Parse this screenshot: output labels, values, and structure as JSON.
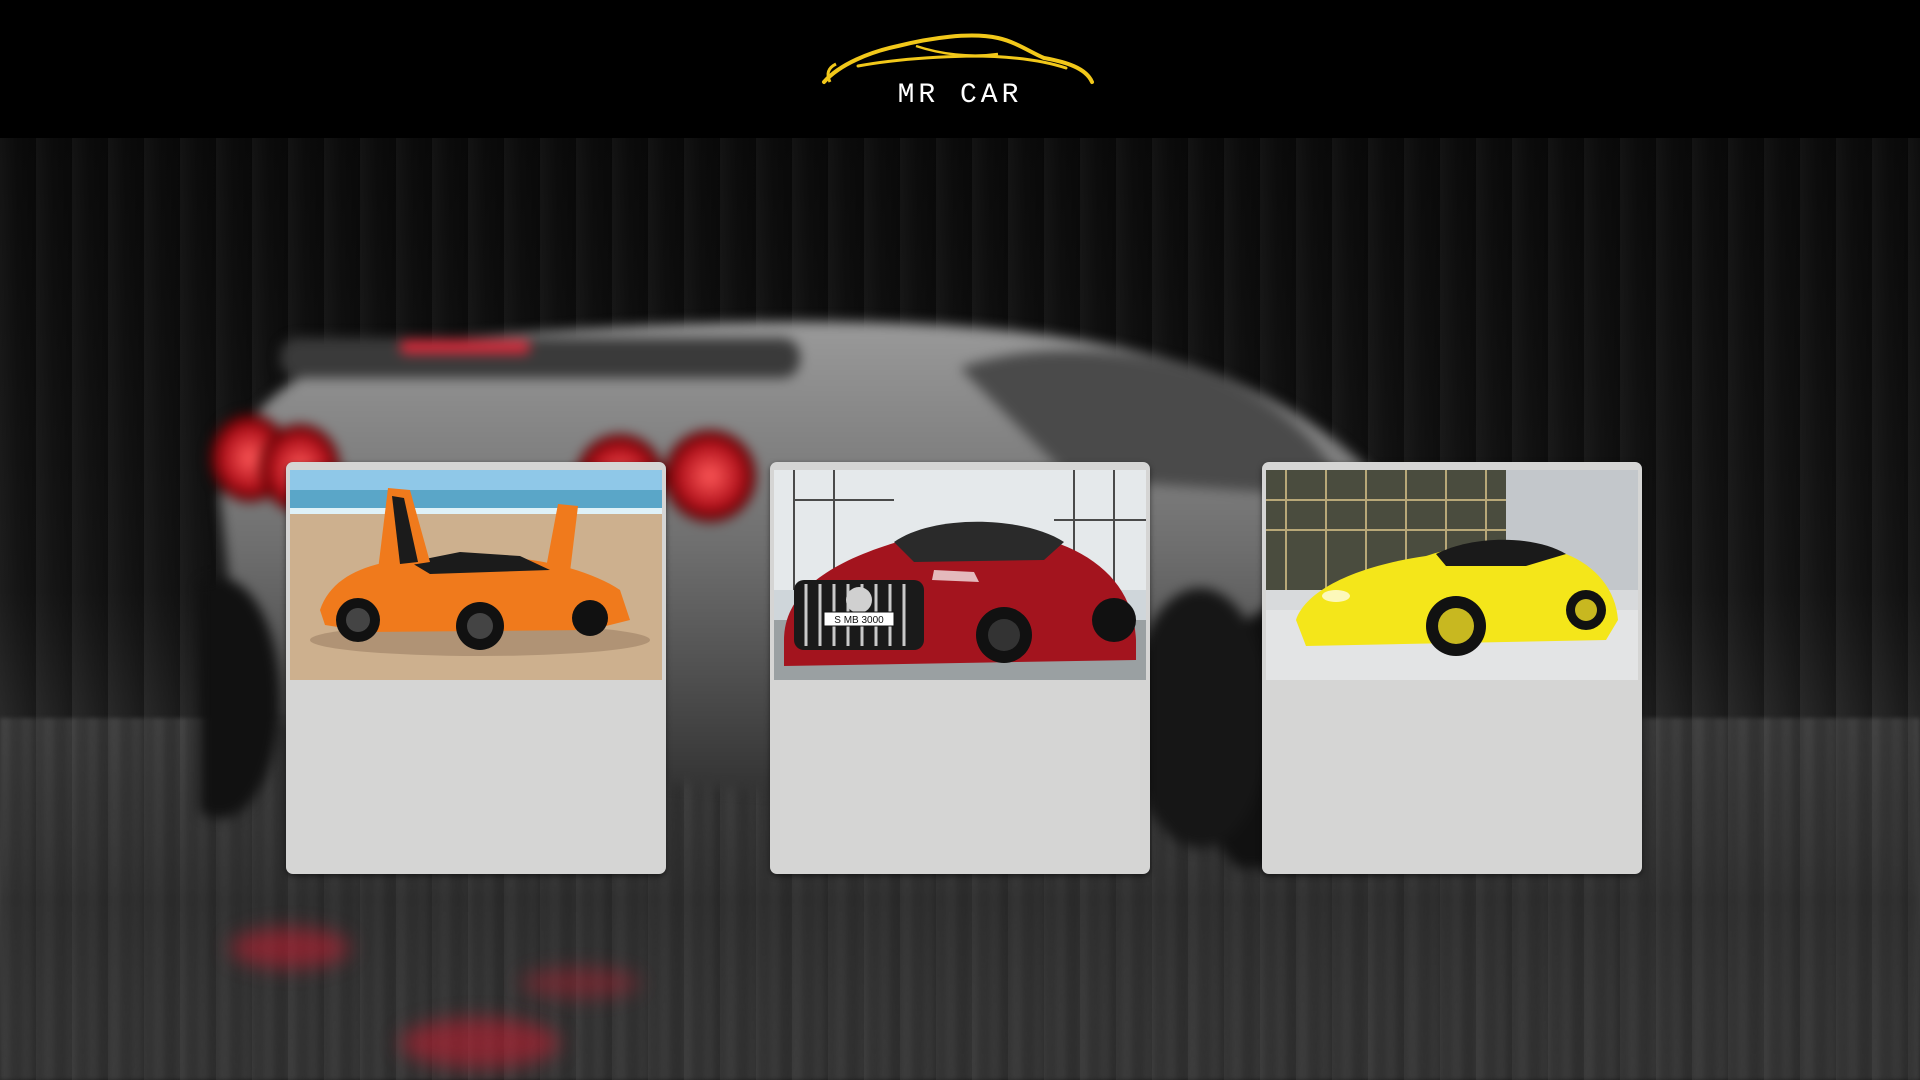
{
  "header": {
    "logo_text": "MR CAR",
    "logo_icon": "car-silhouette-logo-icon",
    "logo_color": "#f2c81a"
  },
  "cards": [
    {
      "image_icon": "orange-supercar-on-beach-image",
      "plate": ""
    },
    {
      "image_icon": "red-sedan-front-image",
      "plate": "S MB 3000"
    },
    {
      "image_icon": "yellow-coupe-image",
      "plate": ""
    }
  ],
  "colors": {
    "page_bg": "#000000",
    "card_bg": "#d5d5d4",
    "accent_gold": "#f2c81a"
  }
}
